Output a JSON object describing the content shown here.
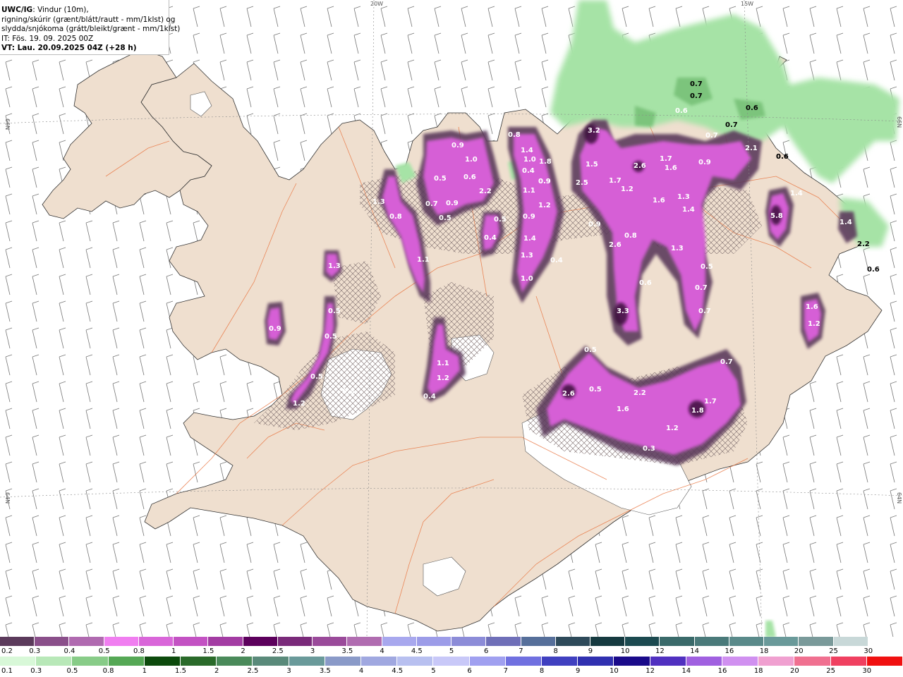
{
  "header": {
    "model": "UWC/IG",
    "line1": ": Vindur (10m),",
    "line2": "rigning/skúrir (grænt/blátt/rautt - mm/1klst) og",
    "line3": "slydda/snjókoma (grátt/bleikt/grænt - mm/1klst)",
    "line4": "IT: Fös. 19. 09. 2025 00Z",
    "line5": "VT: Lau. 20.09.2025 04Z (+28 h)"
  },
  "grid_labels": {
    "lon_20w": "20W",
    "lon_15w": "15W",
    "lat_66n_left": "66N",
    "lat_66n_right": "66N",
    "lat_64n_left": "64N",
    "lat_64n_right": "64N"
  },
  "colors": {
    "land": "#efdfcf",
    "sea": "#ffffff",
    "roads": "#e8703a",
    "rain_green": "#a6e3a6",
    "snow_purple": "#d65fd6",
    "snow_dark": "#4a1a4a"
  },
  "precip_labels": [
    "3.2",
    "2.6",
    "1.5",
    "1.7",
    "1.2",
    "2.5",
    "0.9",
    "1.7",
    "1.6",
    "0.9",
    "2.1",
    "0.6",
    "0.7",
    "1.3",
    "1.4",
    "1.6",
    "1.3",
    "2.6",
    "0.8",
    "0.6",
    "0.5",
    "0.7",
    "0.7",
    "3.3",
    "0.9",
    "1.4",
    "1.0",
    "1.8",
    "0.9",
    "0.4",
    "1.1",
    "1.2",
    "0.9",
    "1.4",
    "1.3",
    "0.4",
    "1.0",
    "0.8",
    "0.5",
    "0.6",
    "2.2",
    "1.0",
    "0.9",
    "0.5",
    "0.7",
    "0.9",
    "0.5",
    "0.4",
    "1.3",
    "0.8",
    "1.1",
    "1.1",
    "1.2",
    "0.4",
    "0.5",
    "0.9",
    "0.5",
    "0.5",
    "1.2",
    "0.3",
    "1.3",
    "5.8",
    "1.4",
    "1.6",
    "1.2",
    "2.6",
    "0.5",
    "2.2",
    "1.6",
    "1.8",
    "1.7",
    "1.2",
    "0.3",
    "0.7",
    "0.5",
    "0.7",
    "0.6",
    "0.7",
    "0.6",
    "0.7",
    "0.6",
    "0.6",
    "2.2",
    "1.4"
  ],
  "snow_scale": {
    "labels": [
      "0.2",
      "0.3",
      "0.4",
      "0.5",
      "0.8",
      "1",
      "1.5",
      "2",
      "2.5",
      "3",
      "3.5",
      "4",
      "4.5",
      "5",
      "6",
      "7",
      "8",
      "9",
      "10",
      "12",
      "14",
      "16",
      "18",
      "20",
      "25",
      "30"
    ],
    "colors": [
      "#5b3a5b",
      "#8a4f8a",
      "#b06ab0",
      "#f07ef0",
      "#d966d9",
      "#c352c3",
      "#a33ca3",
      "#5c005c",
      "#7a2a7a",
      "#9a4a9a",
      "#b06cb0",
      "#a8a8ee",
      "#9c9ce8",
      "#8c8cd8",
      "#6f6fb8",
      "#566f9a",
      "#2e4a5a",
      "#163a40",
      "#1c4a50",
      "#3a6a6a",
      "#4a7a7a",
      "#5a8a8a",
      "#6a9a9a",
      "#7a9a9a",
      "#c8d8d8",
      "#ffffff"
    ]
  },
  "rain_scale": {
    "labels": [
      "0.1",
      "0.3",
      "0.5",
      "0.8",
      "1",
      "1.5",
      "2",
      "2.5",
      "3",
      "3.5",
      "4",
      "4.5",
      "5",
      "6",
      "7",
      "8",
      "9",
      "10",
      "12",
      "14",
      "16",
      "18",
      "20",
      "25",
      "30"
    ],
    "colors": [
      "#d8f8d8",
      "#b8e8b8",
      "#88cc88",
      "#55a855",
      "#0c4a0c",
      "#2a6a2a",
      "#4a8a5a",
      "#5a8a7a",
      "#6a9a9a",
      "#8a9ac8",
      "#a0a8e0",
      "#b8c0f0",
      "#c8c8f8",
      "#a0a0f0",
      "#7070e0",
      "#4040c0",
      "#3030b0",
      "#1a0a8a",
      "#5030c0",
      "#a060e0",
      "#d090f0",
      "#f0a0d0",
      "#f07090",
      "#f04060",
      "#f01010"
    ]
  }
}
